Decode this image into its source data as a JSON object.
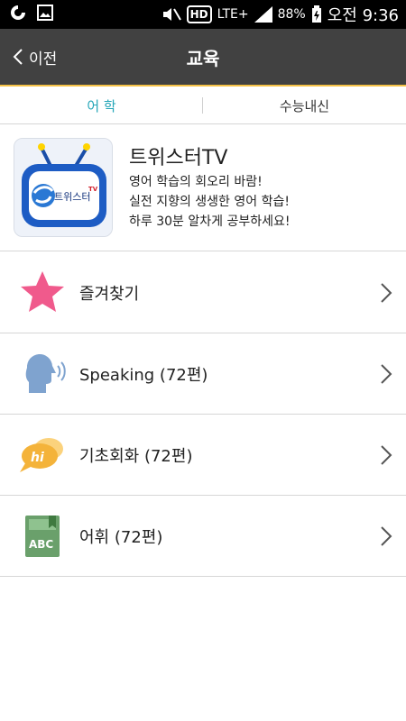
{
  "status_bar": {
    "time": "오전 9:36",
    "battery": "88%",
    "network": "LTE+",
    "hd": "HD"
  },
  "header": {
    "back_label": "이전",
    "title": "교육"
  },
  "tabs": [
    {
      "label": "어 학",
      "active": true
    },
    {
      "label": "수능내신",
      "active": false
    }
  ],
  "feature": {
    "title": "트위스터TV",
    "desc_lines": [
      "영어 학습의 회오리 바람!",
      "실전 지향의 생생한 영어 학습!",
      "하루 30분 알차게 공부하세요!"
    ],
    "logo_text": "트위스터",
    "logo_tv": "TV"
  },
  "list": [
    {
      "label": "즐겨찾기",
      "icon": "star-icon"
    },
    {
      "label": "Speaking (72편)",
      "icon": "speaking-head-icon"
    },
    {
      "label": "기초회화 (72편)",
      "icon": "hi-speech-bubble-icon"
    },
    {
      "label": "어휘 (72편)",
      "icon": "abc-book-icon"
    }
  ],
  "colors": {
    "header_bg": "#414141",
    "active_tab": "#25a6b8",
    "star": "#f05a8c",
    "speaking": "#7fa3cf",
    "bubble": "#f4b33a",
    "book": "#6aa06b"
  }
}
